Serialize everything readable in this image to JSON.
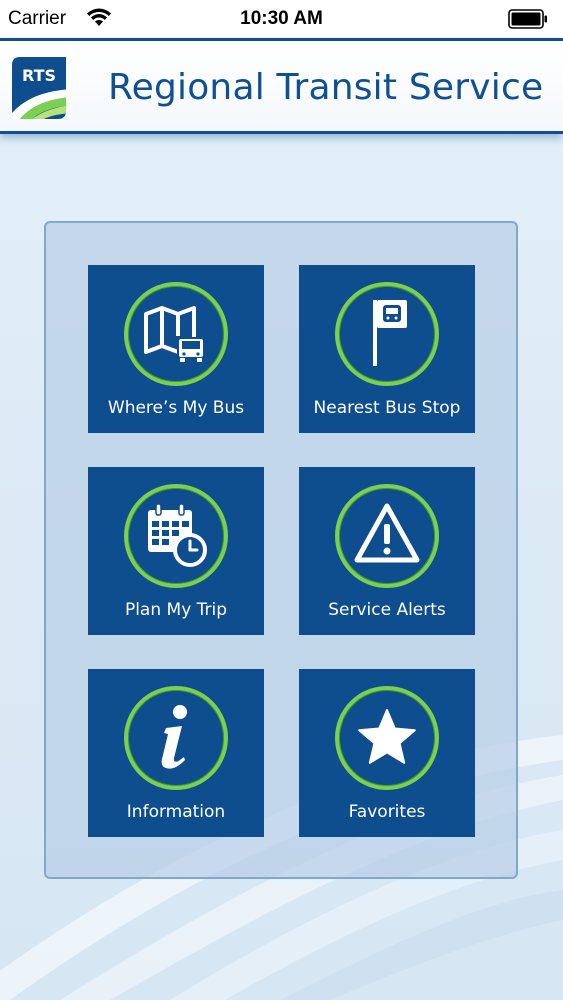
{
  "status_bar": {
    "carrier": "Carrier",
    "time": "10:30 AM"
  },
  "header": {
    "logo_text": "RTS",
    "title": "Regional Transit Service"
  },
  "tiles": [
    {
      "label": "Where’s My Bus",
      "icon": "map-bus-icon"
    },
    {
      "label": "Nearest Bus Stop",
      "icon": "bus-stop-icon"
    },
    {
      "label": "Plan My Trip",
      "icon": "calendar-clock-icon"
    },
    {
      "label": "Service Alerts",
      "icon": "warning-icon"
    },
    {
      "label": "Information",
      "icon": "info-icon"
    },
    {
      "label": "Favorites",
      "icon": "star-icon"
    }
  ],
  "colors": {
    "brand_blue": "#0e4d8e",
    "ring_green": "#7bd04f",
    "background": "#e4eff8"
  }
}
